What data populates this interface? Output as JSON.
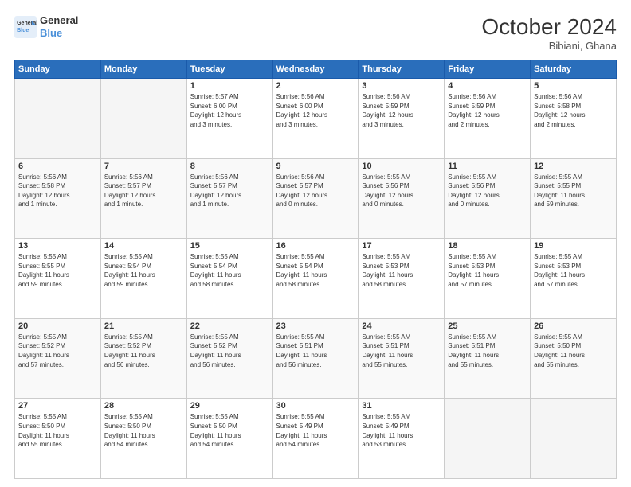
{
  "header": {
    "logo_line1": "General",
    "logo_line2": "Blue",
    "month": "October 2024",
    "location": "Bibiani, Ghana"
  },
  "days_of_week": [
    "Sunday",
    "Monday",
    "Tuesday",
    "Wednesday",
    "Thursday",
    "Friday",
    "Saturday"
  ],
  "weeks": [
    [
      {
        "day": "",
        "info": ""
      },
      {
        "day": "",
        "info": ""
      },
      {
        "day": "1",
        "info": "Sunrise: 5:57 AM\nSunset: 6:00 PM\nDaylight: 12 hours\nand 3 minutes."
      },
      {
        "day": "2",
        "info": "Sunrise: 5:56 AM\nSunset: 6:00 PM\nDaylight: 12 hours\nand 3 minutes."
      },
      {
        "day": "3",
        "info": "Sunrise: 5:56 AM\nSunset: 5:59 PM\nDaylight: 12 hours\nand 3 minutes."
      },
      {
        "day": "4",
        "info": "Sunrise: 5:56 AM\nSunset: 5:59 PM\nDaylight: 12 hours\nand 2 minutes."
      },
      {
        "day": "5",
        "info": "Sunrise: 5:56 AM\nSunset: 5:58 PM\nDaylight: 12 hours\nand 2 minutes."
      }
    ],
    [
      {
        "day": "6",
        "info": "Sunrise: 5:56 AM\nSunset: 5:58 PM\nDaylight: 12 hours\nand 1 minute."
      },
      {
        "day": "7",
        "info": "Sunrise: 5:56 AM\nSunset: 5:57 PM\nDaylight: 12 hours\nand 1 minute."
      },
      {
        "day": "8",
        "info": "Sunrise: 5:56 AM\nSunset: 5:57 PM\nDaylight: 12 hours\nand 1 minute."
      },
      {
        "day": "9",
        "info": "Sunrise: 5:56 AM\nSunset: 5:57 PM\nDaylight: 12 hours\nand 0 minutes."
      },
      {
        "day": "10",
        "info": "Sunrise: 5:55 AM\nSunset: 5:56 PM\nDaylight: 12 hours\nand 0 minutes."
      },
      {
        "day": "11",
        "info": "Sunrise: 5:55 AM\nSunset: 5:56 PM\nDaylight: 12 hours\nand 0 minutes."
      },
      {
        "day": "12",
        "info": "Sunrise: 5:55 AM\nSunset: 5:55 PM\nDaylight: 11 hours\nand 59 minutes."
      }
    ],
    [
      {
        "day": "13",
        "info": "Sunrise: 5:55 AM\nSunset: 5:55 PM\nDaylight: 11 hours\nand 59 minutes."
      },
      {
        "day": "14",
        "info": "Sunrise: 5:55 AM\nSunset: 5:54 PM\nDaylight: 11 hours\nand 59 minutes."
      },
      {
        "day": "15",
        "info": "Sunrise: 5:55 AM\nSunset: 5:54 PM\nDaylight: 11 hours\nand 58 minutes."
      },
      {
        "day": "16",
        "info": "Sunrise: 5:55 AM\nSunset: 5:54 PM\nDaylight: 11 hours\nand 58 minutes."
      },
      {
        "day": "17",
        "info": "Sunrise: 5:55 AM\nSunset: 5:53 PM\nDaylight: 11 hours\nand 58 minutes."
      },
      {
        "day": "18",
        "info": "Sunrise: 5:55 AM\nSunset: 5:53 PM\nDaylight: 11 hours\nand 57 minutes."
      },
      {
        "day": "19",
        "info": "Sunrise: 5:55 AM\nSunset: 5:53 PM\nDaylight: 11 hours\nand 57 minutes."
      }
    ],
    [
      {
        "day": "20",
        "info": "Sunrise: 5:55 AM\nSunset: 5:52 PM\nDaylight: 11 hours\nand 57 minutes."
      },
      {
        "day": "21",
        "info": "Sunrise: 5:55 AM\nSunset: 5:52 PM\nDaylight: 11 hours\nand 56 minutes."
      },
      {
        "day": "22",
        "info": "Sunrise: 5:55 AM\nSunset: 5:52 PM\nDaylight: 11 hours\nand 56 minutes."
      },
      {
        "day": "23",
        "info": "Sunrise: 5:55 AM\nSunset: 5:51 PM\nDaylight: 11 hours\nand 56 minutes."
      },
      {
        "day": "24",
        "info": "Sunrise: 5:55 AM\nSunset: 5:51 PM\nDaylight: 11 hours\nand 55 minutes."
      },
      {
        "day": "25",
        "info": "Sunrise: 5:55 AM\nSunset: 5:51 PM\nDaylight: 11 hours\nand 55 minutes."
      },
      {
        "day": "26",
        "info": "Sunrise: 5:55 AM\nSunset: 5:50 PM\nDaylight: 11 hours\nand 55 minutes."
      }
    ],
    [
      {
        "day": "27",
        "info": "Sunrise: 5:55 AM\nSunset: 5:50 PM\nDaylight: 11 hours\nand 55 minutes."
      },
      {
        "day": "28",
        "info": "Sunrise: 5:55 AM\nSunset: 5:50 PM\nDaylight: 11 hours\nand 54 minutes."
      },
      {
        "day": "29",
        "info": "Sunrise: 5:55 AM\nSunset: 5:50 PM\nDaylight: 11 hours\nand 54 minutes."
      },
      {
        "day": "30",
        "info": "Sunrise: 5:55 AM\nSunset: 5:49 PM\nDaylight: 11 hours\nand 54 minutes."
      },
      {
        "day": "31",
        "info": "Sunrise: 5:55 AM\nSunset: 5:49 PM\nDaylight: 11 hours\nand 53 minutes."
      },
      {
        "day": "",
        "info": ""
      },
      {
        "day": "",
        "info": ""
      }
    ]
  ]
}
